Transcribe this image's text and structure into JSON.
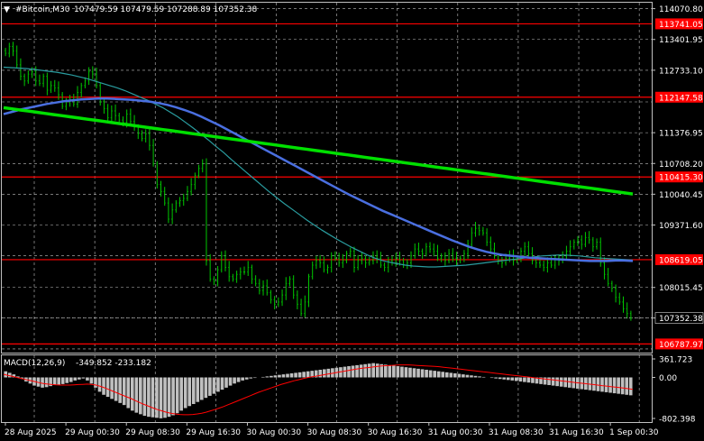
{
  "header": {
    "title": "#Bitcoin,M30",
    "ohlc": "107479.59 107479.59 107288.89 107352.38",
    "triangle": "▼"
  },
  "macd": {
    "label": "MACD(12,26,9)",
    "values": "-349.852 -233.182",
    "ticks": [
      "361.723",
      "0.00",
      "-802.398"
    ]
  },
  "colors": {
    "background": "#000000",
    "grid": "#c0c0c0",
    "candle": "#00c800",
    "level_lines": "#ff0000",
    "ma_fast": "#2a9da0",
    "ma_mid": "#4a6fe0",
    "ma_slow": "#00e000",
    "macd_hist": "#c0c0c0",
    "macd_signal": "#ff0000"
  },
  "chart_data": {
    "type": "candlestick",
    "symbol": "#Bitcoin",
    "timeframe": "M30",
    "y_range": [
      106600,
      114200
    ],
    "price_ticks": [
      "114070.80",
      "113401.95",
      "112733.10",
      "112045.25",
      "111376.95",
      "110708.20",
      "110040.45",
      "109371.60",
      "108702.75",
      "108015.45",
      "107352.38",
      "106678.95"
    ],
    "x_labels": [
      "28 Aug 2025",
      "29 Aug 00:30",
      "29 Aug 08:30",
      "29 Aug 16:30",
      "30 Aug 00:30",
      "30 Aug 08:30",
      "30 Aug 16:30",
      "31 Aug 00:30",
      "31 Aug 08:30",
      "31 Aug 16:30",
      "1 Sep 00:30"
    ],
    "level_lines": [
      {
        "value": 113741.05,
        "label": "113741.05"
      },
      {
        "value": 112147.58,
        "label": "112147.58"
      },
      {
        "value": 110415.3,
        "label": "110415.30"
      },
      {
        "value": 108619.05,
        "label": "108619.05"
      },
      {
        "value": 106787.97,
        "label": "106787.97"
      }
    ],
    "current_price": 107352.38,
    "closes": [
      113100,
      113250,
      113150,
      112850,
      112600,
      112500,
      112650,
      112700,
      112500,
      112450,
      112600,
      112300,
      112400,
      112350,
      112200,
      111950,
      112050,
      112100,
      112000,
      112250,
      112400,
      112500,
      112700,
      112650,
      112400,
      112050,
      111900,
      111700,
      111850,
      111750,
      111650,
      111600,
      111780,
      111620,
      111500,
      111350,
      111250,
      111350,
      111100,
      110700,
      110250,
      110100,
      109850,
      109500,
      109700,
      109850,
      109900,
      109950,
      110100,
      110250,
      110450,
      110600,
      110700,
      108600,
      108200,
      108150,
      108400,
      108700,
      108450,
      108250,
      108200,
      108300,
      108350,
      108350,
      108450,
      108200,
      108100,
      107950,
      108050,
      107900,
      107750,
      107650,
      107700,
      107850,
      108100,
      108200,
      107850,
      107650,
      107450,
      107700,
      108250,
      108500,
      108600,
      108550,
      108400,
      108450,
      108700,
      108650,
      108550,
      108600,
      108750,
      108800,
      108450,
      108600,
      108650,
      108550,
      108600,
      108700,
      108650,
      108500,
      108450,
      108600,
      108550,
      108650,
      108600,
      108500,
      108550,
      108700,
      108850,
      108800,
      108750,
      108900,
      108850,
      108800,
      108650,
      108700,
      108600,
      108750,
      108650,
      108600,
      108650,
      108750,
      108950,
      109200,
      109300,
      109250,
      109200,
      109000,
      108850,
      108700,
      108600,
      108550,
      108650,
      108700,
      108600,
      108650,
      108800,
      108900,
      108750,
      108600,
      108550,
      108500,
      108450,
      108550,
      108500,
      108650,
      108600,
      108700,
      108800,
      108900,
      109000,
      109050,
      108950,
      109100,
      109050,
      108900,
      109000,
      108550,
      108300,
      108100,
      108000,
      107800,
      107700,
      107550,
      107450,
      107352.38
    ],
    "series": [
      {
        "name": "MA fast",
        "values": [
          112800,
          112790,
          112780,
          112770,
          112750,
          112730,
          112710,
          112690,
          112660,
          112630,
          112590,
          112550,
          112500,
          112450,
          112400,
          112350,
          112290,
          112220,
          112150,
          112080,
          112000,
          111920,
          111820,
          111720,
          111600,
          111480,
          111350,
          111220,
          111080,
          110950,
          110800,
          110660,
          110520,
          110380,
          110240,
          110100,
          109970,
          109840,
          109720,
          109600,
          109480,
          109370,
          109260,
          109160,
          109060,
          108970,
          108880,
          108800,
          108720,
          108650,
          108600,
          108560,
          108530,
          108500,
          108480,
          108470,
          108460,
          108460,
          108470,
          108480,
          108490,
          108500,
          108520,
          108540,
          108560,
          108580,
          108600,
          108620,
          108640,
          108660,
          108680,
          108700,
          108710,
          108720,
          108720,
          108710,
          108700,
          108680,
          108660,
          108650,
          108640,
          108630,
          108620,
          108610
        ]
      },
      {
        "name": "MA mid",
        "values": [
          111780,
          111830,
          111880,
          111920,
          111960,
          112000,
          112030,
          112060,
          112080,
          112100,
          112110,
          112120,
          112120,
          112110,
          112100,
          112090,
          112070,
          112050,
          112020,
          111980,
          111930,
          111870,
          111800,
          111720,
          111630,
          111540,
          111440,
          111340,
          111240,
          111140,
          111040,
          110940,
          110840,
          110740,
          110640,
          110540,
          110440,
          110340,
          110240,
          110140,
          110040,
          109950,
          109860,
          109770,
          109680,
          109600,
          109520,
          109440,
          109360,
          109280,
          109200,
          109120,
          109040,
          108970,
          108900,
          108840,
          108790,
          108750,
          108720,
          108700,
          108680,
          108660,
          108650,
          108640,
          108630,
          108620,
          108610,
          108600,
          108590,
          108590,
          108590,
          108600,
          108600,
          108590
        ]
      },
      {
        "name": "MA slow",
        "values": [
          111920,
          111895,
          111870,
          111845,
          111820,
          111795,
          111770,
          111745,
          111720,
          111695,
          111670,
          111645,
          111620,
          111595,
          111570,
          111545,
          111520,
          111495,
          111470,
          111445,
          111420,
          111395,
          111370,
          111345,
          111320,
          111295,
          111270,
          111245,
          111220,
          111195,
          111170,
          111145,
          111120,
          111095,
          111070,
          111045,
          111020,
          110995,
          110970,
          110945,
          110920,
          110895,
          110870,
          110845,
          110820,
          110795,
          110770,
          110745,
          110720,
          110695,
          110670,
          110645,
          110620,
          110595,
          110570,
          110545,
          110520,
          110495,
          110470,
          110445,
          110420,
          110395,
          110370,
          110345,
          110320,
          110295,
          110270,
          110245,
          110220,
          110195,
          110170,
          110145,
          110120,
          110095,
          110070,
          110045
        ]
      }
    ],
    "macd_hist": [
      120,
      90,
      60,
      20,
      -30,
      -80,
      -120,
      -160,
      -180,
      -200,
      -190,
      -170,
      -150,
      -140,
      -130,
      -110,
      -90,
      -60,
      -40,
      -20,
      -60,
      -120,
      -200,
      -280,
      -340,
      -380,
      -420,
      -460,
      -500,
      -540,
      -600,
      -650,
      -690,
      -720,
      -750,
      -770,
      -780,
      -790,
      -800,
      -790,
      -770,
      -740,
      -700,
      -650,
      -600,
      -560,
      -520,
      -480,
      -440,
      -400,
      -360,
      -320,
      -280,
      -240,
      -200,
      -160,
      -120,
      -90,
      -60,
      -40,
      -20,
      -10,
      0,
      10,
      20,
      30,
      40,
      50,
      60,
      70,
      80,
      90,
      100,
      110,
      120,
      130,
      140,
      150,
      160,
      170,
      180,
      190,
      200,
      210,
      220,
      230,
      240,
      250,
      260,
      270,
      280,
      270,
      260,
      250,
      240,
      230,
      220,
      210,
      200,
      190,
      180,
      170,
      160,
      150,
      140,
      130,
      120,
      110,
      100,
      90,
      80,
      70,
      60,
      50,
      40,
      30,
      20,
      10,
      0,
      -10,
      -20,
      -30,
      -40,
      -50,
      -60,
      -70,
      -80,
      -90,
      -100,
      -110,
      -120,
      -130,
      -140,
      -150,
      -160,
      -170,
      -180,
      -190,
      -200,
      -210,
      -220,
      -230,
      -240,
      -250,
      -260,
      -270,
      -280,
      -290,
      -300,
      -310,
      -320,
      -330,
      -340,
      -349.852
    ],
    "macd_signal": [
      60,
      40,
      20,
      0,
      -20,
      -40,
      -60,
      -80,
      -100,
      -120,
      -130,
      -140,
      -145,
      -150,
      -150,
      -150,
      -145,
      -140,
      -135,
      -130,
      -135,
      -150,
      -175,
      -205,
      -240,
      -275,
      -310,
      -345,
      -380,
      -415,
      -455,
      -495,
      -530,
      -565,
      -600,
      -630,
      -655,
      -680,
      -700,
      -715,
      -725,
      -730,
      -730,
      -725,
      -715,
      -700,
      -680,
      -655,
      -630,
      -600,
      -570,
      -535,
      -500,
      -465,
      -430,
      -395,
      -360,
      -325,
      -290,
      -260,
      -230,
      -200,
      -170,
      -140,
      -115,
      -90,
      -65,
      -45,
      -25,
      -5,
      10,
      25,
      40,
      55,
      70,
      85,
      100,
      115,
      130,
      145,
      160,
      175,
      185,
      195,
      205,
      215,
      225,
      230,
      235,
      240,
      245,
      245,
      245,
      240,
      235,
      230,
      225,
      220,
      215,
      210,
      200,
      190,
      180,
      170,
      160,
      150,
      140,
      130,
      120,
      110,
      100,
      90,
      80,
      70,
      60,
      50,
      40,
      30,
      20,
      10,
      0,
      -10,
      -20,
      -30,
      -40,
      -50,
      -60,
      -70,
      -80,
      -90,
      -100,
      -110,
      -120,
      -130,
      -140,
      -150,
      -160,
      -170,
      -180,
      -190,
      -200,
      -210,
      -220,
      -233.182
    ]
  }
}
